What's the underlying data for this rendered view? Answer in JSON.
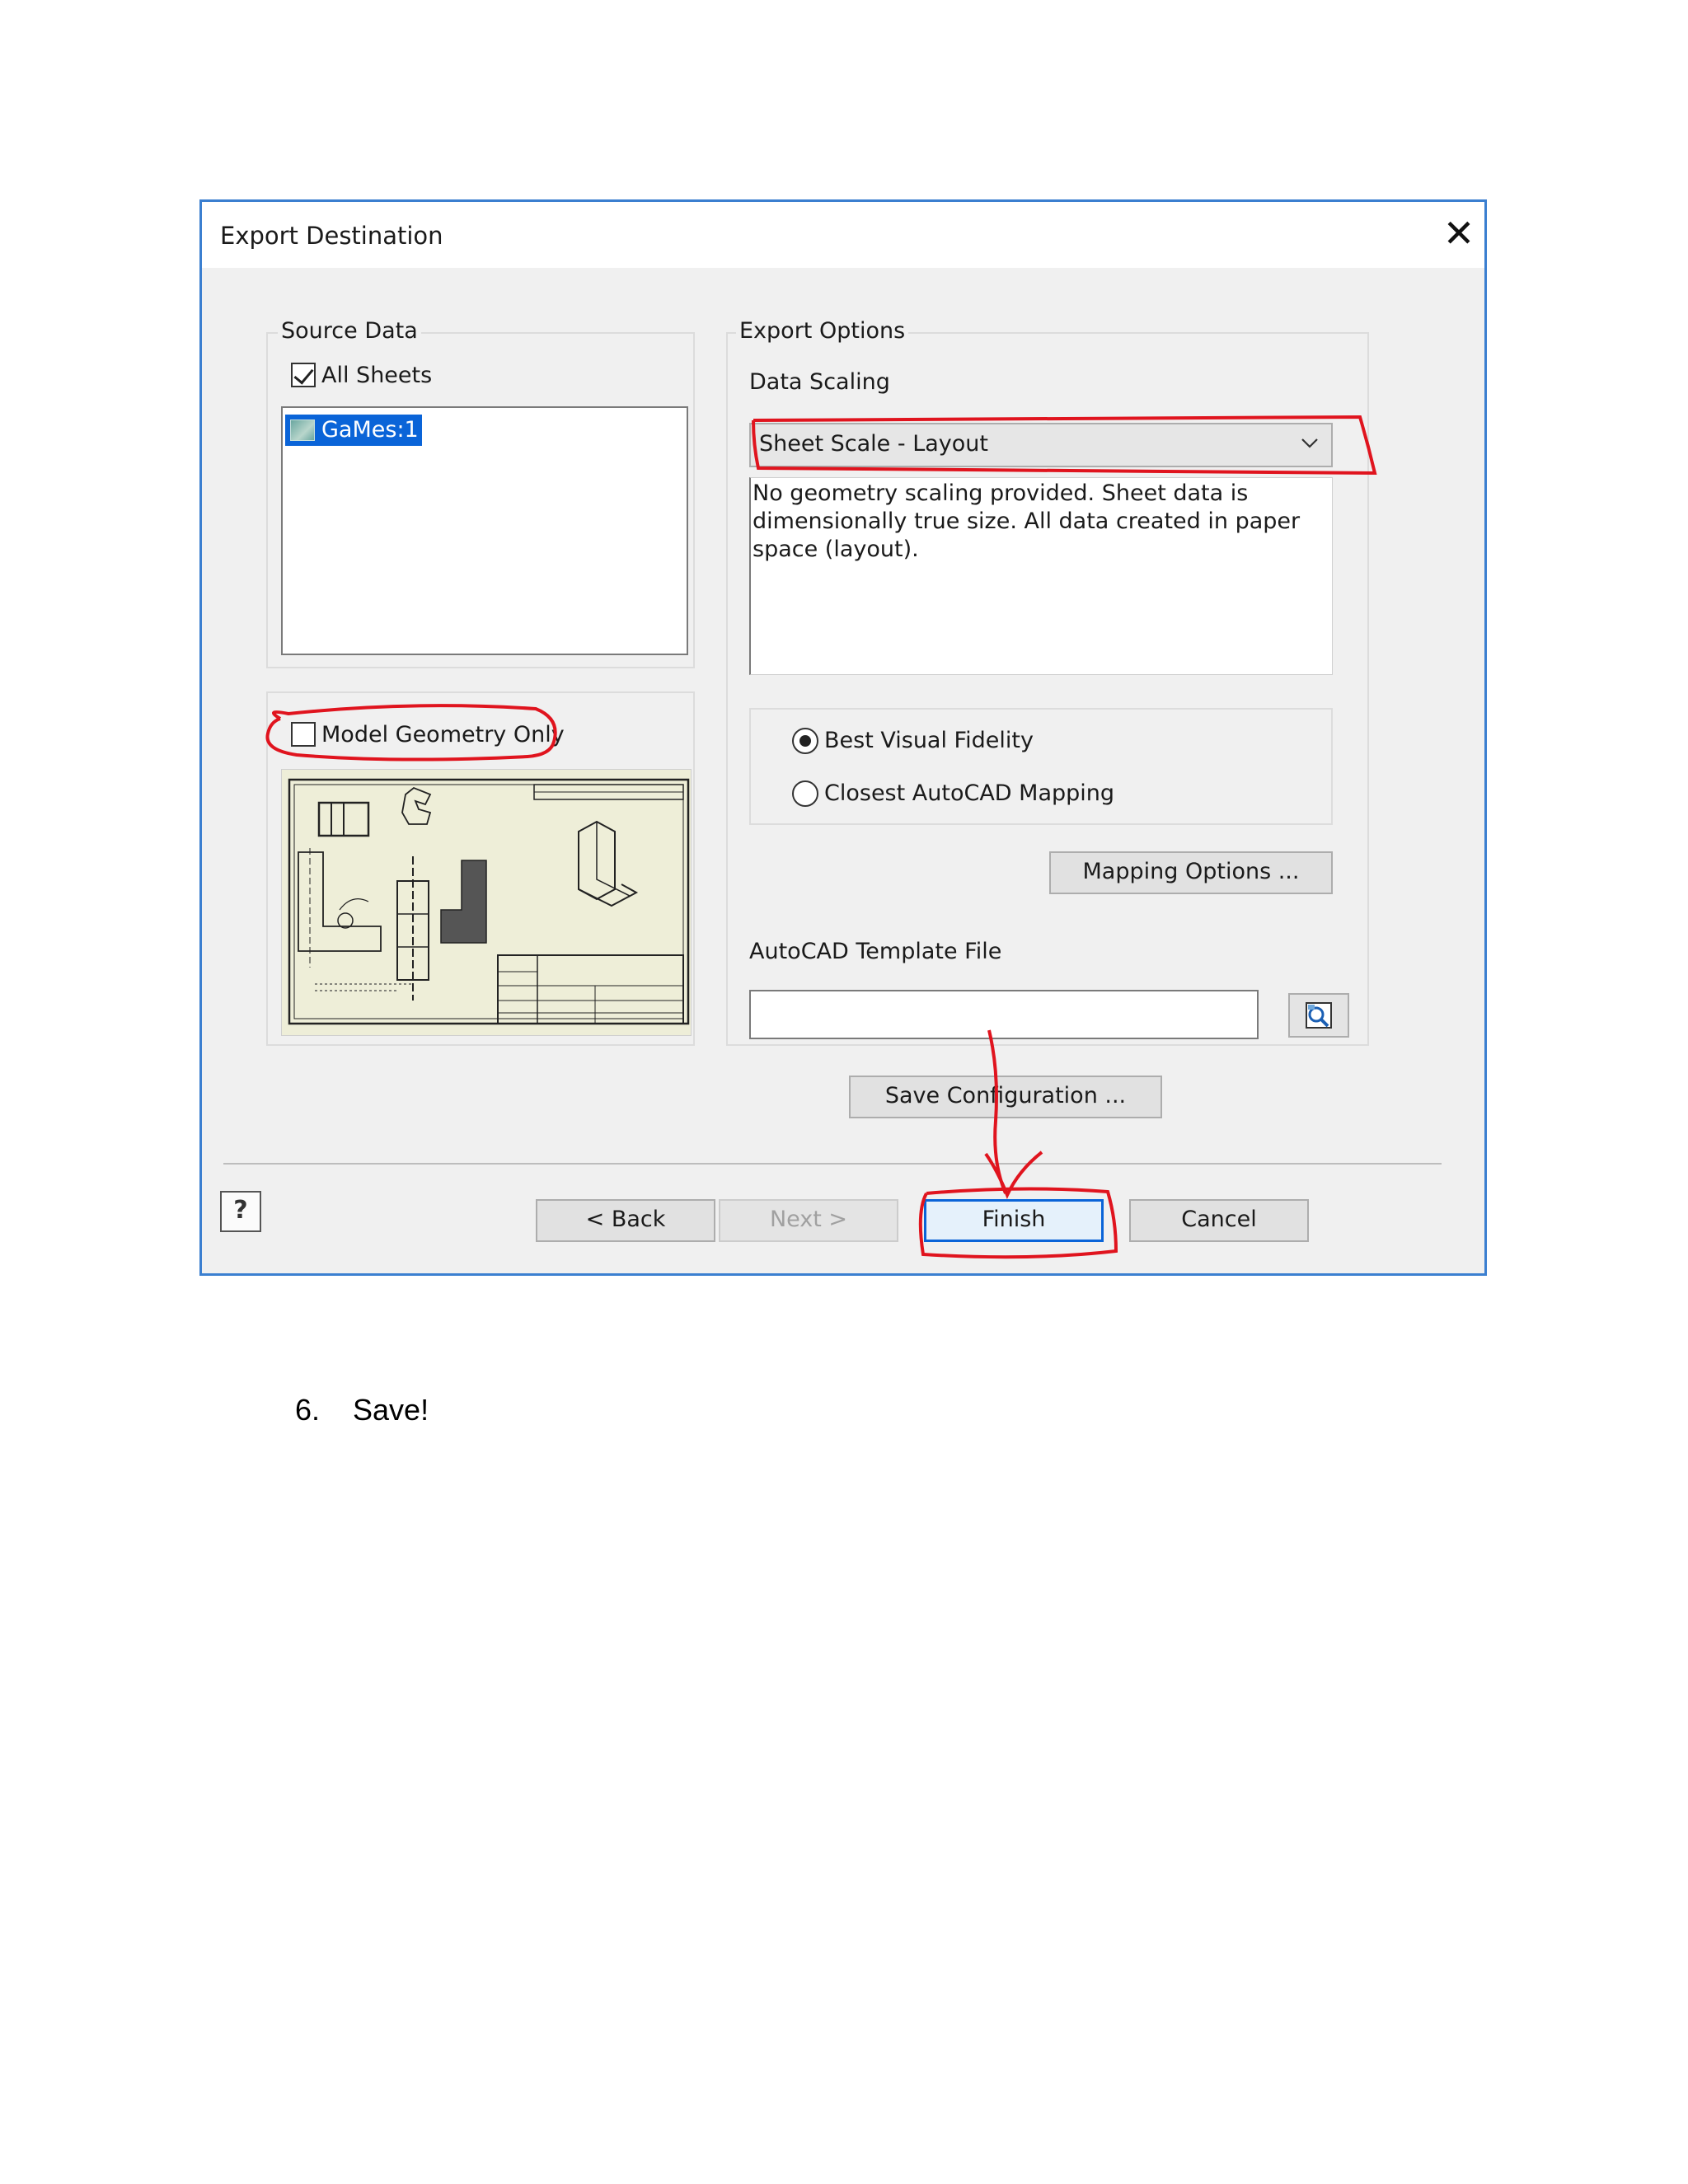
{
  "dialog": {
    "title": "Export Destination",
    "close_glyph": "✕",
    "source_data": {
      "label": "Source Data",
      "all_sheets_label": "All Sheets",
      "all_sheets_checked": true,
      "sheets": [
        "GaMes:1"
      ]
    },
    "model_geometry": {
      "label": "Model Geometry Only",
      "checked": false
    },
    "export_options": {
      "label": "Export Options",
      "data_scaling_label": "Data Scaling",
      "data_scaling_value": "Sheet Scale - Layout",
      "description": "No geometry scaling provided. Sheet data is dimensionally true size. All data created in paper space (layout).",
      "fidelity_options": [
        {
          "label": "Best Visual Fidelity",
          "selected": true
        },
        {
          "label": "Closest AutoCAD Mapping",
          "selected": false
        }
      ],
      "mapping_options_label": "Mapping Options ...",
      "template_label": "AutoCAD Template File",
      "template_value": ""
    },
    "save_configuration_label": "Save Configuration ...",
    "buttons": {
      "help": "?",
      "back": "< Back",
      "next": "Next >",
      "finish": "Finish",
      "cancel": "Cancel"
    }
  },
  "annotation_color": "#e0141e",
  "footnote": {
    "number": "6.",
    "text": "Save!"
  }
}
